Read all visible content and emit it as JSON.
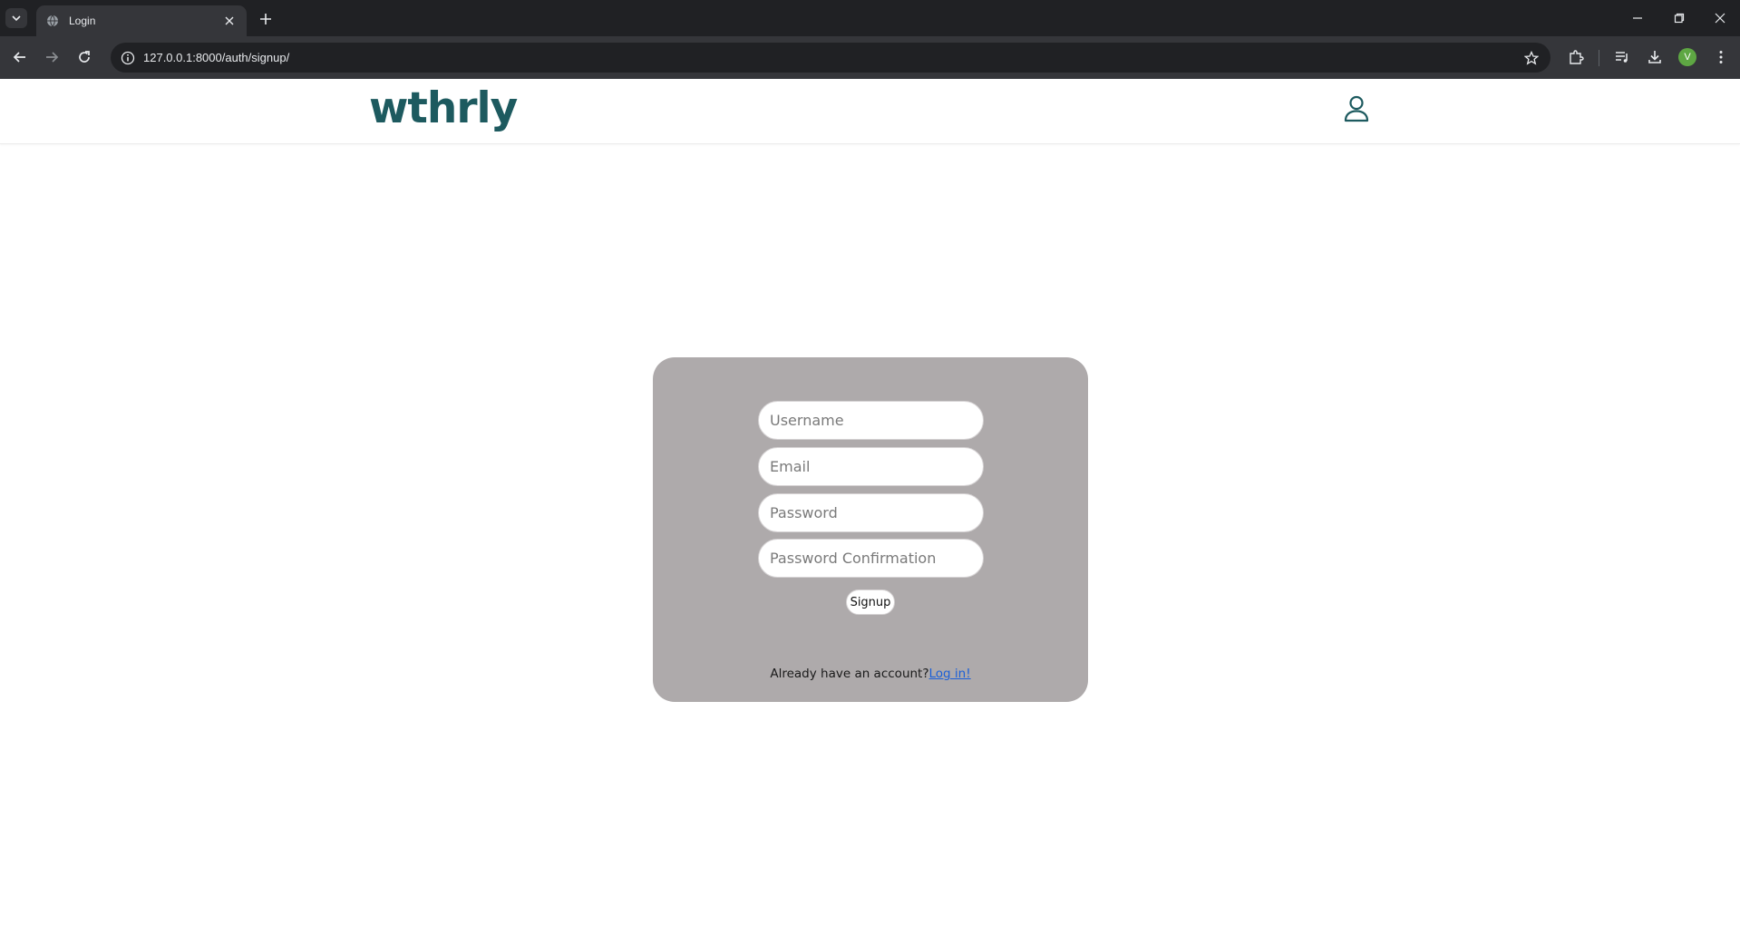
{
  "browser": {
    "tab_title": "Login",
    "url": "127.0.0.1:8000/auth/signup/",
    "profile_initial": "V"
  },
  "site": {
    "logo": "wthrly",
    "brand_color": "#1d5a5f"
  },
  "signup_form": {
    "username_placeholder": "Username",
    "email_placeholder": "Email",
    "password_placeholder": "Password",
    "password_confirmation_placeholder": "Password Confirmation",
    "submit_label": "Signup",
    "already_text": "Already have an account?",
    "login_link": "Log in!",
    "card_color": "#aeaaab"
  }
}
